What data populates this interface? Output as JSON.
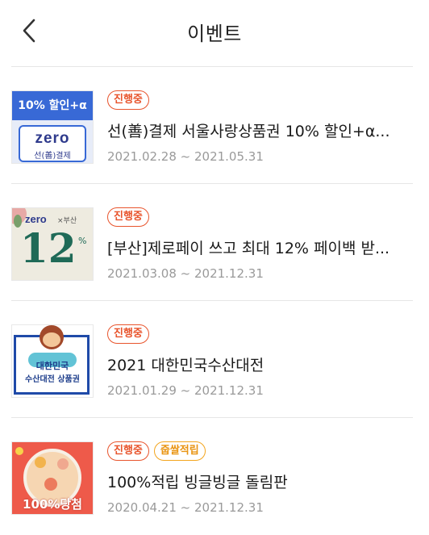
{
  "header": {
    "title": "이벤트",
    "back_icon": "chevron-left-icon"
  },
  "colors": {
    "accent": "#e8542c",
    "reward": "#f3a51d",
    "divider": "#e6e6e6",
    "date": "#9a9a9a"
  },
  "events": [
    {
      "badges": [
        "진행중"
      ],
      "title": "선(善)결제 서울사랑상품권 10% 할인+α...",
      "date": "2021.02.28 ~ 2021.05.31",
      "thumb": {
        "top": "10% 할인+α",
        "logo": "zero",
        "sub": "선(善)결제"
      }
    },
    {
      "badges": [
        "진행중"
      ],
      "title": "[부산]제로페이 쓰고 최대 12% 페이백 받...",
      "date": "2021.03.08 ~ 2021.12.31",
      "thumb": {
        "logo": "zero",
        "region": "×부산",
        "big": "12",
        "pct": "%"
      }
    },
    {
      "badges": [
        "진행중"
      ],
      "title": "2021 대한민국수산대전",
      "date": "2021.01.29 ~ 2021.12.31",
      "thumb": {
        "line1": "대한민국",
        "line2": "수산대전 상품권"
      }
    },
    {
      "badges": [
        "진행중",
        "줍쌀적립"
      ],
      "title": "100%적립 빙글빙글 돌림판",
      "date": "2020.04.21 ~ 2021.12.31",
      "thumb": {
        "text": "100%당첨"
      }
    }
  ]
}
